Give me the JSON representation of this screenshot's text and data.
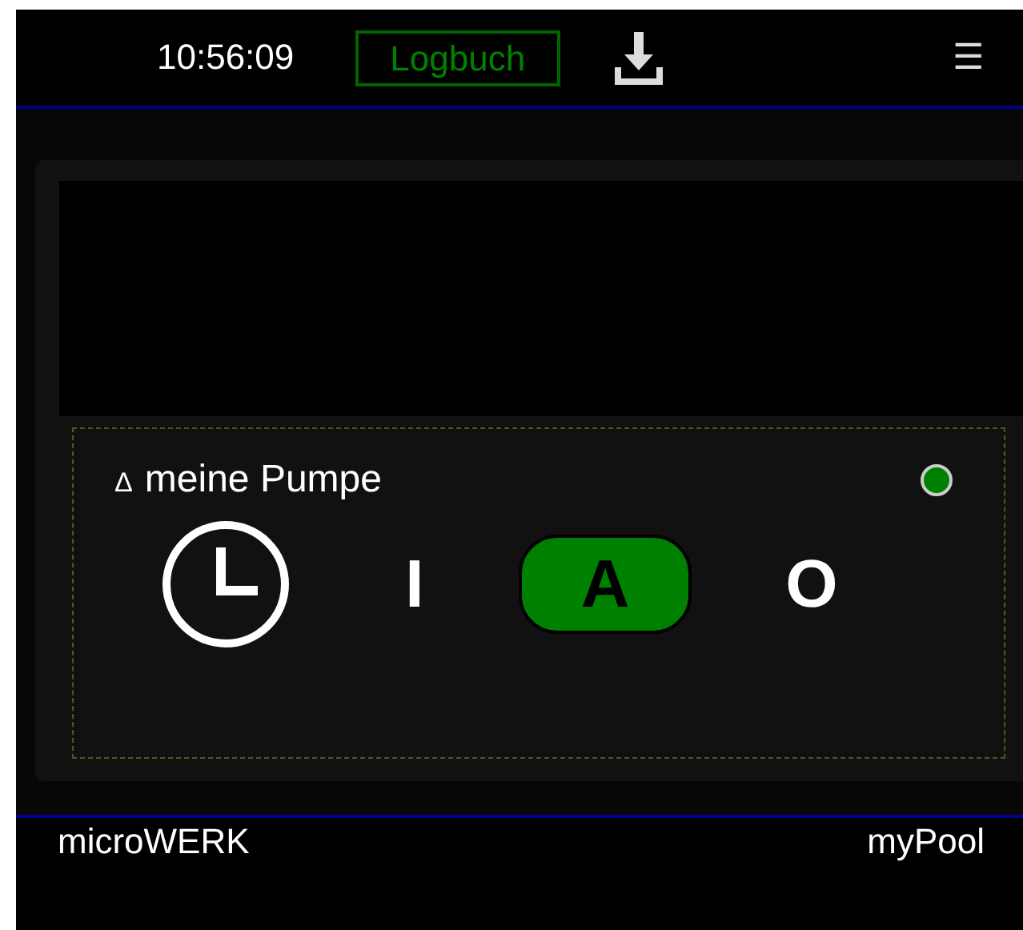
{
  "header": {
    "time": "10:56:09",
    "logbook_button": "Logbuch",
    "menu_glyph": "☰"
  },
  "device": {
    "marker": "∆",
    "name": "meine Pumpe",
    "color": "#008000",
    "modes": [
      {
        "kind": "clock",
        "selected": false
      },
      {
        "kind": "text",
        "label": "I",
        "selected": false
      },
      {
        "kind": "text",
        "label": "A",
        "selected": true
      },
      {
        "kind": "text",
        "label": "O",
        "selected": false
      }
    ]
  },
  "footer": {
    "left": "microWERK",
    "right": "myPool"
  }
}
